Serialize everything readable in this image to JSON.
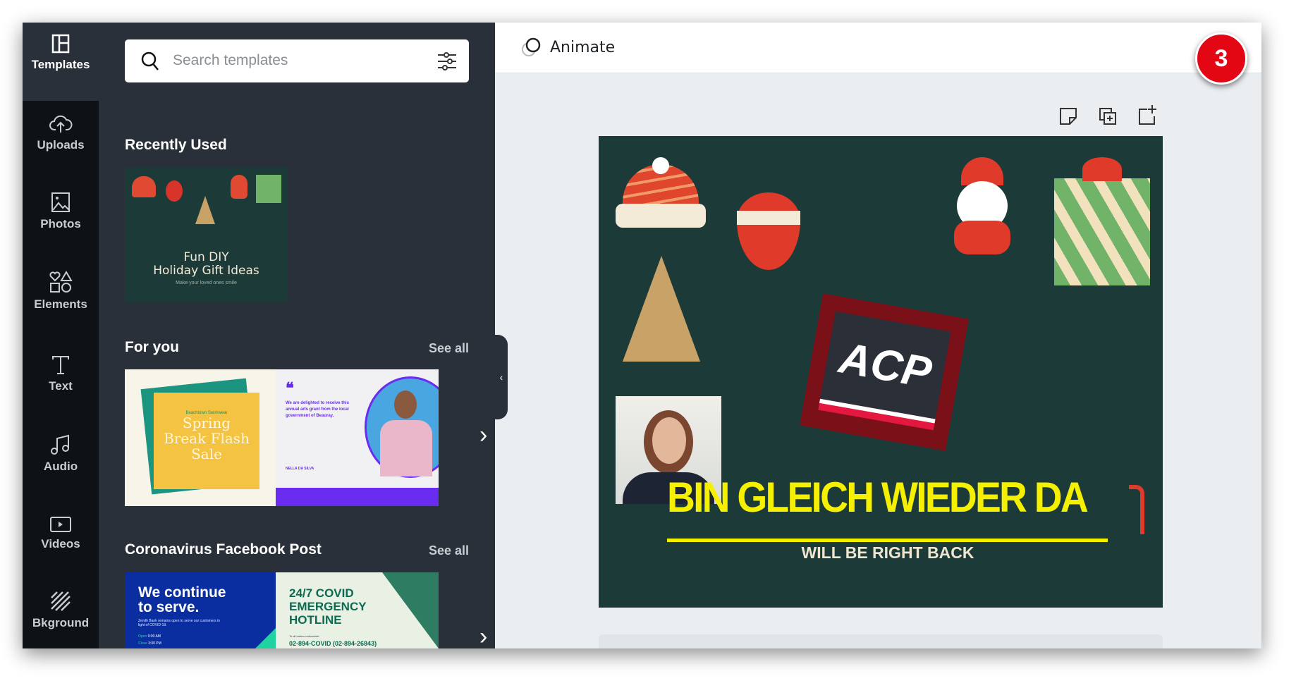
{
  "nav": [
    {
      "label": "Templates",
      "icon": "templates-icon"
    },
    {
      "label": "Uploads",
      "icon": "upload-cloud-icon"
    },
    {
      "label": "Photos",
      "icon": "photo-icon"
    },
    {
      "label": "Elements",
      "icon": "shapes-icon"
    },
    {
      "label": "Text",
      "icon": "text-icon"
    },
    {
      "label": "Audio",
      "icon": "music-note-icon"
    },
    {
      "label": "Videos",
      "icon": "video-icon"
    },
    {
      "label": "Bkground",
      "icon": "background-stripes-icon"
    }
  ],
  "search": {
    "placeholder": "Search templates"
  },
  "recent": {
    "heading": "Recently Used",
    "items": [
      {
        "title": "Fun DIY\nHoliday Gift Ideas",
        "subtitle": "Make your loved ones smile"
      }
    ]
  },
  "foryou": {
    "heading": "For you",
    "see_all": "See all",
    "items": [
      {
        "title": "Spring Break Flash Sale",
        "brand": "Beachtown Swimwear"
      },
      {
        "quote": "We are delighted to receive this annual arts grant from the local government of Beauray.",
        "name": "NELLA DA SILVA"
      }
    ]
  },
  "corona": {
    "heading": "Coronavirus Facebook Post",
    "see_all": "See all",
    "items": [
      {
        "title": "We continue to serve.",
        "body": "Zenith Bank remains open to serve our customers in light of COVID-19.",
        "open_label": "Open",
        "open": "9:00 AM",
        "close_label": "Close",
        "close": "3:00 PM"
      },
      {
        "title": "24/7 COVID EMERGENCY HOTLINE",
        "body": "To all callers nationwide:",
        "phone": "02-894-COVID (02-894-26843)"
      }
    ]
  },
  "header": {
    "animate_label": "Animate"
  },
  "step_badge": "3",
  "design": {
    "logo_text": "ACP",
    "headline": "BIN GLEICH WIEDER DA",
    "subheadline": "WILL BE RIGHT BACK",
    "background": "#1c3a38",
    "headline_color": "#f4f000"
  },
  "colors": {
    "panel": "#293039",
    "rail": "#0e1116",
    "badge": "#e30613"
  }
}
